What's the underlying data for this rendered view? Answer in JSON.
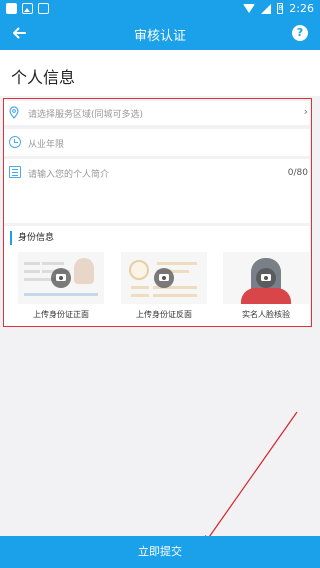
{
  "status_bar": {
    "time": "2:26",
    "battery_level": "8",
    "icons": [
      "notification-square-icon",
      "image-icon",
      "text-icon",
      "wifi-icon",
      "signal-icon",
      "battery-icon"
    ]
  },
  "app_bar": {
    "title": "审核认证",
    "back_icon": "arrow-left-icon",
    "help_icon": "question-mark-icon",
    "help_glyph": "?"
  },
  "personal_info": {
    "heading": "个人信息",
    "service_area": {
      "placeholder": "请选择服务区域(同城可多选)",
      "icon": "location-pin-icon"
    },
    "years": {
      "placeholder": "从业年限",
      "icon": "clock-icon"
    },
    "intro": {
      "placeholder": "请输入您的个人简介",
      "counter": "0/80",
      "icon": "document-icon"
    }
  },
  "identity": {
    "heading": "身份信息",
    "uploads": [
      {
        "label": "上传身份证正面"
      },
      {
        "label": "上传身份证反面"
      },
      {
        "label": "实名人脸核验"
      }
    ]
  },
  "submit_label": "立即提交",
  "colors": {
    "primary": "#1aa1e9",
    "highlight_border": "#e0303a",
    "background": "#f2f2f4"
  }
}
